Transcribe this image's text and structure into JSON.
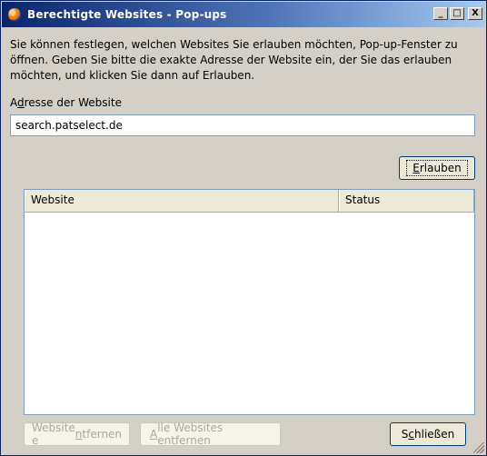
{
  "window": {
    "title": "Berechtigte Websites - Pop-ups",
    "controls": {
      "minimize": "_",
      "maximize": "□",
      "close": "X"
    }
  },
  "intro": "Sie können festlegen, welchen Websites Sie erlauben möchten, Pop-up-Fenster zu öffnen. Geben Sie bitte die exakte Adresse der Website ein, der Sie das erlauben möchten, und klicken Sie dann auf Erlauben.",
  "address": {
    "label_prefix": "A",
    "label_accel": "d",
    "label_rest": "resse der Website",
    "value": "search.patselect.de"
  },
  "allow_button": {
    "accel": "E",
    "rest": "rlauben"
  },
  "table": {
    "columns": [
      "Website",
      "Status"
    ],
    "rows": []
  },
  "footer": {
    "remove": {
      "pre": "Website e",
      "accel": "n",
      "post": "tfernen"
    },
    "remove_all": {
      "pre": "",
      "accel": "A",
      "post": "lle Websites entfernen"
    },
    "close": {
      "pre": "S",
      "accel": "c",
      "post": "hließen"
    }
  }
}
